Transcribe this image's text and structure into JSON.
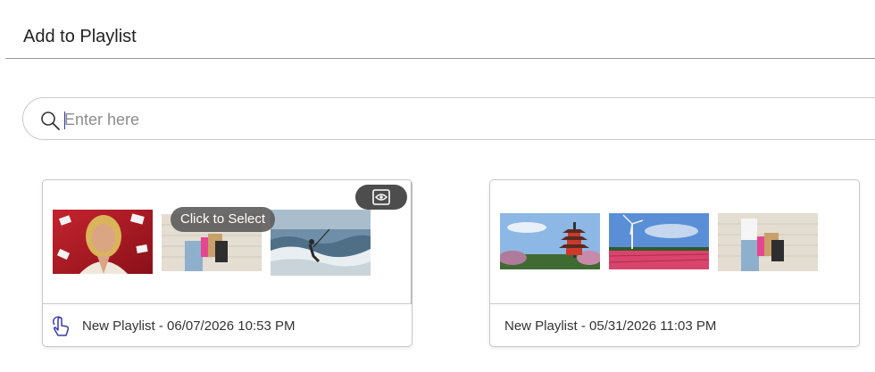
{
  "dialog": {
    "title": "Add to Playlist"
  },
  "search": {
    "placeholder": "Enter here",
    "value": ""
  },
  "playlists": [
    {
      "name": "New Playlist - 06/07/2026 10:53 PM",
      "hover_tooltip": "Click to Select",
      "thumbnails": [
        "woman-shopping-sale",
        "woman-shopping-bags-brick-wall",
        "kitesurfer-waves"
      ]
    },
    {
      "name": "New Playlist - 05/31/2026 11:03 PM",
      "thumbnails": [
        "japanese-pagoda",
        "windmill-tulip-field",
        "woman-shopping-bags-brick-wall"
      ]
    }
  ],
  "icons": {
    "search": "search-icon",
    "preview": "eye-icon",
    "select": "tap-hand-icon"
  },
  "colors": {
    "accent": "#3a3aaa",
    "tooltip_bg": "#585858",
    "preview_btn_bg": "#4d4d4d"
  }
}
